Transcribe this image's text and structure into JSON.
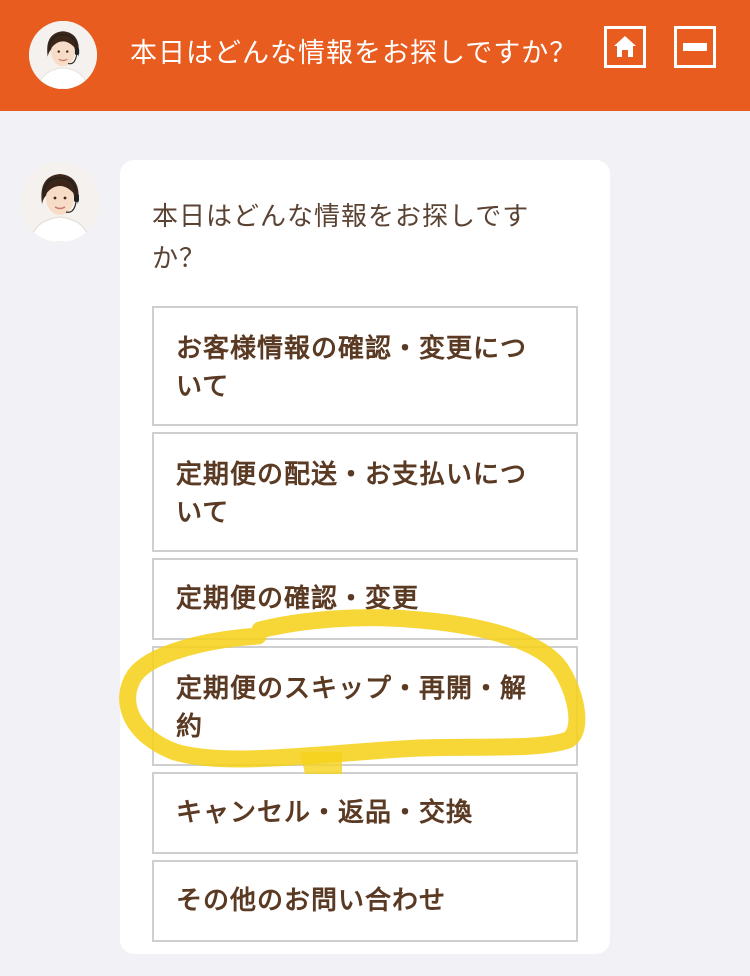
{
  "header": {
    "title": "本日はどんな情報をお探しですか？",
    "home_icon": "home-icon",
    "minimize_icon": "minimize-icon",
    "accent_color": "#e85d1f"
  },
  "chat": {
    "prompt": "本日はどんな情報をお探しですか？",
    "options": [
      {
        "label": "お客様情報の確認・変更について"
      },
      {
        "label": "定期便の配送・お支払いについて"
      },
      {
        "label": "定期便の確認・変更"
      },
      {
        "label": "定期便のスキップ・再開・解約"
      },
      {
        "label": "キャンセル・返品・交換"
      },
      {
        "label": "その他のお問い合わせ"
      }
    ]
  },
  "annotation": {
    "highlight_color": "#f6d21b"
  }
}
